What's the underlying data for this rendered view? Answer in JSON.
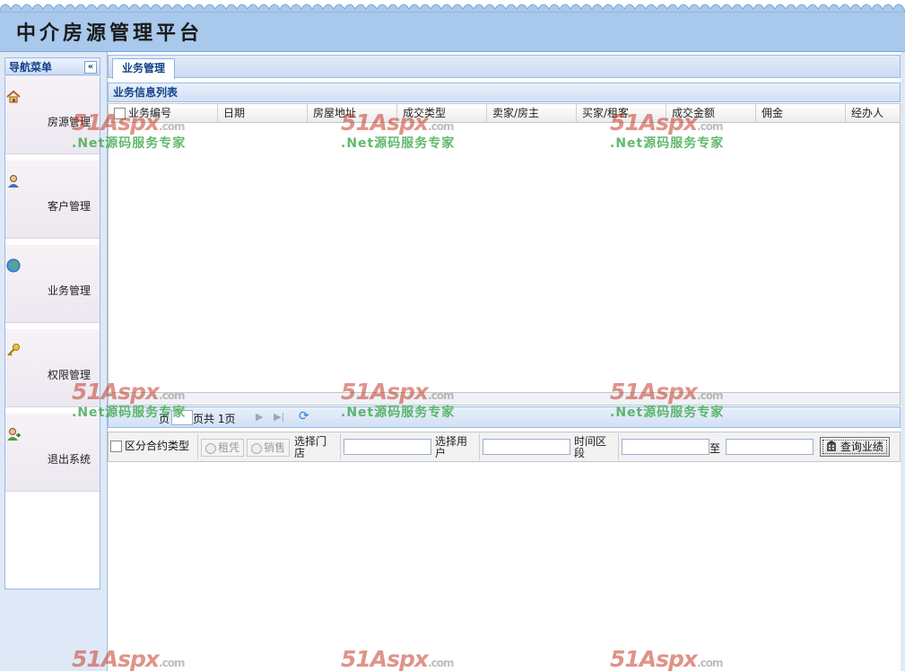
{
  "app": {
    "title": "中介房源管理平台"
  },
  "nav": {
    "header": "导航菜单",
    "collapse": "«",
    "items": [
      {
        "label": "房源管理",
        "icon": "home-icon"
      },
      {
        "label": "客户管理",
        "icon": "user-icon"
      },
      {
        "label": "业务管理",
        "icon": "globe-icon"
      },
      {
        "label": "权限管理",
        "icon": "key-icon"
      },
      {
        "label": "退出系统",
        "icon": "logout-user-icon"
      }
    ]
  },
  "tab": {
    "label": "业务管理"
  },
  "panel": {
    "title": "业务信息列表"
  },
  "grid": {
    "columns": [
      "业务编号",
      "日期",
      "房屋地址",
      "成交类型",
      "卖家/房主",
      "买家/租客",
      "成交金额",
      "佣金",
      "经办人"
    ]
  },
  "pager": {
    "page_prefix": "页",
    "page_value": "",
    "page_total": "页共 1页"
  },
  "query": {
    "contract_check": "区分合约类型",
    "radio_rent": "租凭",
    "radio_sale": "销售",
    "store_label": "选择门店",
    "user_label": "选择用户",
    "time_label": "时间区段",
    "to_label": "至",
    "search_button": "查询业绩"
  },
  "watermark": {
    "brand": "51Aspx",
    "suffix": ".com",
    "slogan": ".Net源码服务专家"
  }
}
